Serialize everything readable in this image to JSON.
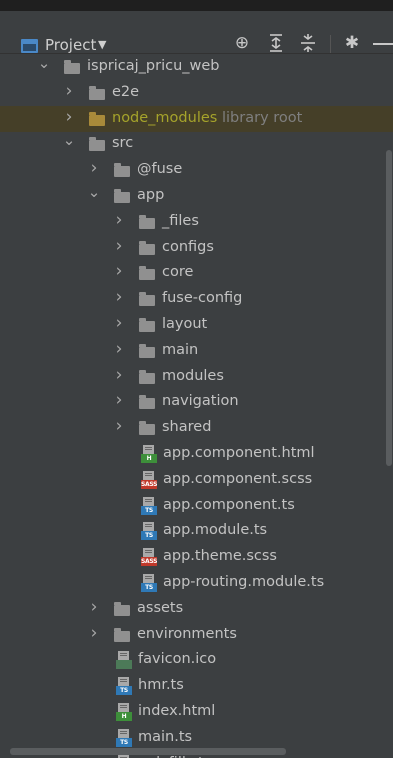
{
  "header": {
    "title": "Project",
    "icons": [
      "locate-icon",
      "expand-all-icon",
      "collapse-all-icon",
      "gear-icon",
      "hide-icon"
    ]
  },
  "tree": [
    {
      "label": "ispricaj_pricu_web",
      "type": "folder",
      "depth": 0,
      "expanded": true
    },
    {
      "label": "e2e",
      "type": "folder",
      "depth": 1,
      "expanded": false
    },
    {
      "label": "node_modules",
      "type": "folder",
      "depth": 1,
      "expanded": false,
      "suffix": "library root",
      "library": true
    },
    {
      "label": "src",
      "type": "folder",
      "depth": 1,
      "expanded": true
    },
    {
      "label": "@fuse",
      "type": "folder",
      "depth": 2,
      "expanded": false
    },
    {
      "label": "app",
      "type": "folder",
      "depth": 2,
      "expanded": true
    },
    {
      "label": "_files",
      "type": "folder",
      "depth": 3,
      "expanded": false
    },
    {
      "label": "configs",
      "type": "folder",
      "depth": 3,
      "expanded": false
    },
    {
      "label": "core",
      "type": "folder",
      "depth": 3,
      "expanded": false
    },
    {
      "label": "fuse-config",
      "type": "folder",
      "depth": 3,
      "expanded": false
    },
    {
      "label": "layout",
      "type": "folder",
      "depth": 3,
      "expanded": false
    },
    {
      "label": "main",
      "type": "folder",
      "depth": 3,
      "expanded": false
    },
    {
      "label": "modules",
      "type": "folder",
      "depth": 3,
      "expanded": false
    },
    {
      "label": "navigation",
      "type": "folder",
      "depth": 3,
      "expanded": false
    },
    {
      "label": "shared",
      "type": "folder",
      "depth": 3,
      "expanded": false
    },
    {
      "label": "app.component.html",
      "type": "file",
      "filetype": "html",
      "depth": 4
    },
    {
      "label": "app.component.scss",
      "type": "file",
      "filetype": "sass",
      "depth": 4
    },
    {
      "label": "app.component.ts",
      "type": "file",
      "filetype": "ts",
      "depth": 4
    },
    {
      "label": "app.module.ts",
      "type": "file",
      "filetype": "ts",
      "depth": 4
    },
    {
      "label": "app.theme.scss",
      "type": "file",
      "filetype": "sass",
      "depth": 4
    },
    {
      "label": "app-routing.module.ts",
      "type": "file",
      "filetype": "ts",
      "depth": 4
    },
    {
      "label": "assets",
      "type": "folder",
      "depth": 2,
      "expanded": false
    },
    {
      "label": "environments",
      "type": "folder",
      "depth": 2,
      "expanded": false
    },
    {
      "label": "favicon.ico",
      "type": "file",
      "filetype": "ico",
      "depth": 3
    },
    {
      "label": "hmr.ts",
      "type": "file",
      "filetype": "ts",
      "depth": 3
    },
    {
      "label": "index.html",
      "type": "file",
      "filetype": "html",
      "depth": 3
    },
    {
      "label": "main.ts",
      "type": "file",
      "filetype": "ts",
      "depth": 3
    },
    {
      "label": "polyfills.ts",
      "type": "file",
      "filetype": "ts",
      "depth": 3
    }
  ],
  "tags": {
    "html": "H",
    "sass": "SASS",
    "ts": "TS",
    "ico": ""
  }
}
